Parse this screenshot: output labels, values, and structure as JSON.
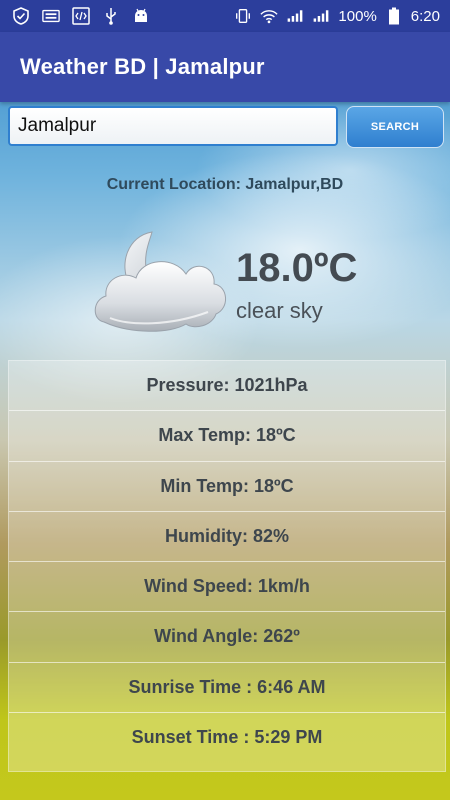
{
  "status_bar": {
    "battery": "100%",
    "time": "6:20",
    "icons": [
      "shield-check-icon",
      "keyboard-icon",
      "code-icon",
      "usb-icon",
      "android-icon",
      "vibrate-icon",
      "wifi-icon",
      "signal-icon",
      "signal-icon",
      "battery-icon"
    ]
  },
  "app_bar": {
    "title": "Weather BD | Jamalpur"
  },
  "search": {
    "value": "Jamalpur",
    "placeholder": "",
    "button_label": "SEARCH"
  },
  "current": {
    "location": "Current Location: Jamalpur,BD",
    "temperature": "18.0ºC",
    "description": "clear sky",
    "icon": "night-cloud-icon"
  },
  "details": [
    "Pressure: 1021hPa",
    "Max Temp: 18ºC",
    "Min Temp: 18ºC",
    "Humidity: 82%",
    "Wind Speed: 1km/h",
    "Wind Angle: 262º",
    "Sunrise Time : 6:46 AM",
    "Sunset Time : 5:29 PM"
  ],
  "colors": {
    "status_bar": "#2c3e9c",
    "app_bar": "#3849a8",
    "accent": "#2f7fcf"
  }
}
